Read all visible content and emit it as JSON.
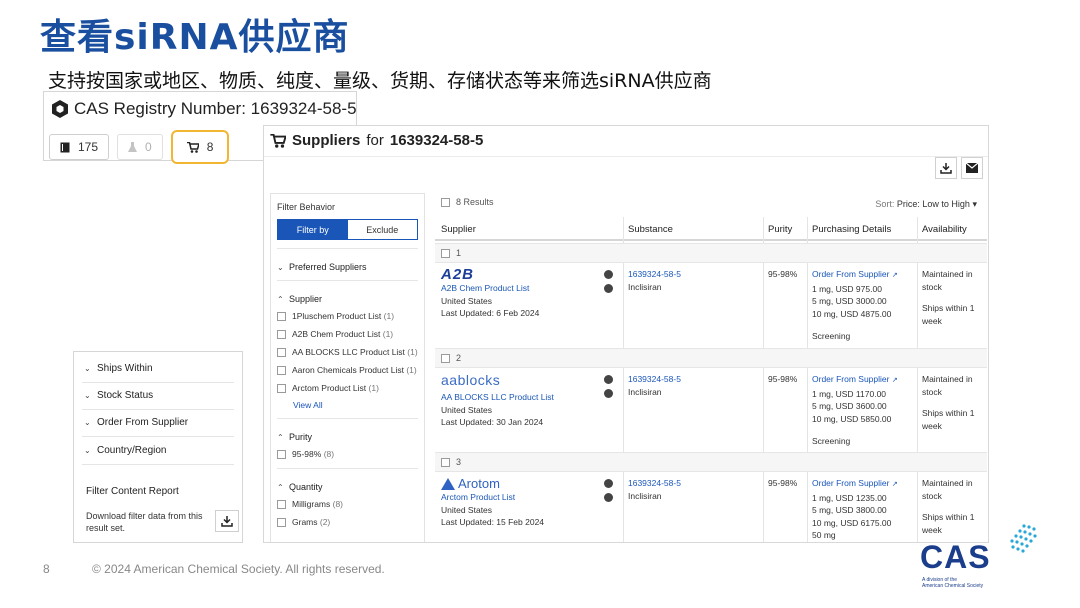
{
  "slide": {
    "title": "查看siRNA供应商",
    "subtitle": "支持按国家或地区、物质、纯度、量级、货期、存储状态等来筛选siRNA供应商",
    "page_number": "8",
    "copyright": "© 2024 American Chemical Society. All rights reserved."
  },
  "registry": {
    "title": "CAS Registry Number: 1639324-58-5",
    "tabs": [
      {
        "icon": "book-icon",
        "count": "175",
        "state": "normal"
      },
      {
        "icon": "flask-icon",
        "count": "0",
        "state": "disabled"
      },
      {
        "icon": "cart-icon",
        "count": "8",
        "state": "active"
      }
    ]
  },
  "suppliers": {
    "heading_prefix": "Suppliers",
    "heading_for": "for",
    "heading_cas": "1639324-58-5",
    "results_count": "8 Results",
    "sort_label": "Sort:",
    "sort_value": "Price: Low to High",
    "columns": [
      "Supplier",
      "Substance",
      "Purity",
      "Purchasing Details",
      "Availability"
    ],
    "filter": {
      "behavior_label": "Filter Behavior",
      "filter_by": "Filter by",
      "exclude": "Exclude",
      "preferred": "Preferred Suppliers",
      "supplier_label": "Supplier",
      "supplier_items": [
        {
          "name": "1Pluschem Product List",
          "count": "(1)"
        },
        {
          "name": "A2B Chem Product List",
          "count": "(1)"
        },
        {
          "name": "AA BLOCKS LLC Product List",
          "count": "(1)"
        },
        {
          "name": "Aaron Chemicals Product List",
          "count": "(1)"
        },
        {
          "name": "Arctom Product List",
          "count": "(1)"
        }
      ],
      "view_all": "View All",
      "purity_label": "Purity",
      "purity_items": [
        {
          "name": "95-98%",
          "count": "(8)"
        }
      ],
      "quantity_label": "Quantity",
      "quantity_items": [
        {
          "name": "Milligrams",
          "count": "(8)"
        },
        {
          "name": "Grams",
          "count": "(2)"
        }
      ]
    },
    "rows": [
      {
        "index": "1",
        "logo": "A2B",
        "name": "A2B Chem Product List",
        "country": "United States",
        "updated": "Last Updated: 6 Feb 2024",
        "cas": "1639324-58-5",
        "substance": "Inclisiran",
        "purity": "95-98%",
        "order": "Order From Supplier",
        "prices": [
          "1 mg, USD 975.00",
          "5 mg, USD 3000.00",
          "10 mg, USD 4875.00"
        ],
        "screening": "Screening",
        "stock": "Maintained in stock",
        "ships": "Ships within 1 week"
      },
      {
        "index": "2",
        "logo": "aablocks",
        "name": "AA BLOCKS LLC Product List",
        "country": "United States",
        "updated": "Last Updated: 30 Jan 2024",
        "cas": "1639324-58-5",
        "substance": "Inclisiran",
        "purity": "95-98%",
        "order": "Order From Supplier",
        "prices": [
          "1 mg, USD 1170.00",
          "5 mg, USD 3600.00",
          "10 mg, USD 5850.00"
        ],
        "screening": "Screening",
        "stock": "Maintained in stock",
        "ships": "Ships within 1 week"
      },
      {
        "index": "3",
        "logo": "Arotom",
        "name": "Arctom Product List",
        "country": "United States",
        "updated": "Last Updated: 15 Feb 2024",
        "cas": "1639324-58-5",
        "substance": "Inclisiran",
        "purity": "95-98%",
        "order": "Order From Supplier",
        "prices": [
          "1 mg, USD 1235.00",
          "5 mg, USD 3800.00",
          "10 mg, USD 6175.00",
          "50 mg"
        ],
        "stock": "Maintained in stock",
        "ships": "Ships within 1 week"
      }
    ]
  },
  "mini_filters": {
    "items": [
      "Ships Within",
      "Stock Status",
      "Order From Supplier",
      "Country/Region"
    ],
    "report_title": "Filter Content Report",
    "report_desc": "Download filter data from this result set."
  },
  "brand": {
    "name": "CAS",
    "sub_line1": "A division of the",
    "sub_line2": "American Chemical Society"
  }
}
